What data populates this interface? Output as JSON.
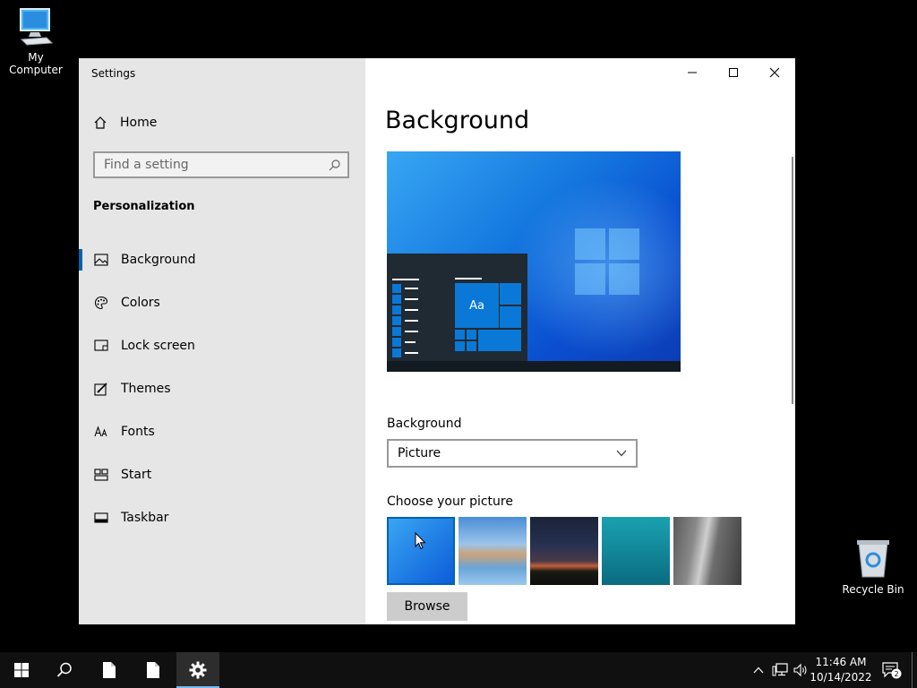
{
  "desktop": {
    "my_computer": "My Computer",
    "recycle_bin": "Recycle Bin"
  },
  "window": {
    "title": "Settings",
    "controls": {
      "minimize": "minimize-icon",
      "maximize": "maximize-icon",
      "close": "close-icon"
    }
  },
  "sidebar": {
    "home": "Home",
    "search_placeholder": "Find a setting",
    "section": "Personalization",
    "items": [
      {
        "label": "Background",
        "icon": "picture-icon",
        "active": true
      },
      {
        "label": "Colors",
        "icon": "palette-icon"
      },
      {
        "label": "Lock screen",
        "icon": "lock-screen-icon"
      },
      {
        "label": "Themes",
        "icon": "themes-icon"
      },
      {
        "label": "Fonts",
        "icon": "fonts-icon"
      },
      {
        "label": "Start",
        "icon": "start-icon"
      },
      {
        "label": "Taskbar",
        "icon": "taskbar-icon"
      }
    ]
  },
  "main": {
    "title": "Background",
    "preview_tile_text": "Aa",
    "background_label": "Background",
    "background_value": "Picture",
    "choose_label": "Choose your picture",
    "browse": "Browse"
  },
  "taskbar": {
    "time": "11:46 AM",
    "date": "10/14/2022",
    "notification_count": "2",
    "accent": "#76b9ed"
  }
}
